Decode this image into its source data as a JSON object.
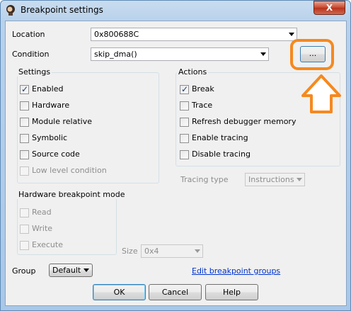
{
  "window": {
    "title": "Breakpoint settings",
    "close_label": "X"
  },
  "location": {
    "label": "Location",
    "value": "0x800688C"
  },
  "condition": {
    "label": "Condition",
    "value": "skip_dma()",
    "browse_label": "..."
  },
  "settings": {
    "title": "Settings",
    "items": [
      {
        "label": "Enabled",
        "checked": true,
        "enabled": true
      },
      {
        "label": "Hardware",
        "checked": false,
        "enabled": true
      },
      {
        "label": "Module relative",
        "checked": false,
        "enabled": true
      },
      {
        "label": "Symbolic",
        "checked": false,
        "enabled": true
      },
      {
        "label": "Source code",
        "checked": false,
        "enabled": true
      },
      {
        "label": "Low level condition",
        "checked": false,
        "enabled": false
      }
    ]
  },
  "actions": {
    "title": "Actions",
    "items": [
      {
        "label": "Break",
        "checked": true,
        "enabled": true
      },
      {
        "label": "Trace",
        "checked": false,
        "enabled": true
      },
      {
        "label": "Refresh debugger memory",
        "checked": false,
        "enabled": true
      },
      {
        "label": "Enable tracing",
        "checked": false,
        "enabled": true
      },
      {
        "label": "Disable tracing",
        "checked": false,
        "enabled": true
      }
    ]
  },
  "tracing_type": {
    "label": "Tracing type",
    "value": "Instructions"
  },
  "hw_mode": {
    "title": "Hardware breakpoint mode",
    "items": [
      {
        "label": "Read",
        "checked": false,
        "enabled": false
      },
      {
        "label": "Write",
        "checked": false,
        "enabled": false
      },
      {
        "label": "Execute",
        "checked": false,
        "enabled": false
      }
    ]
  },
  "size": {
    "label": "Size",
    "value": "0x4"
  },
  "group": {
    "label": "Group",
    "value": "Default",
    "edit_link": "Edit breakpoint groups"
  },
  "buttons": {
    "ok": "OK",
    "cancel": "Cancel",
    "help": "Help"
  },
  "annotation": {
    "color": "#f5891f"
  }
}
